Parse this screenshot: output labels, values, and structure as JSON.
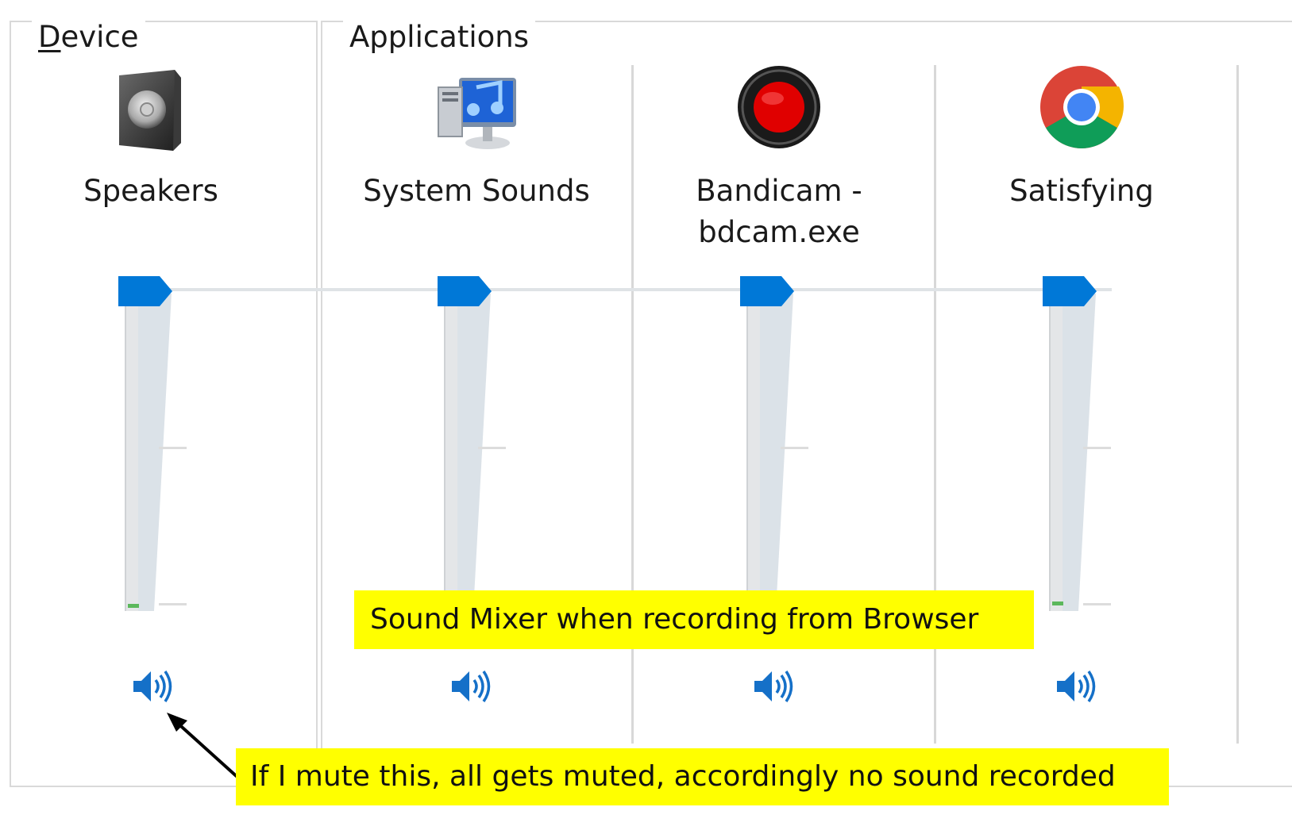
{
  "device": {
    "group_label_mnemonic": "D",
    "group_label_rest": "evice",
    "channel": {
      "name": "Speakers",
      "icon": "speaker-device-icon",
      "volume": 1.0,
      "muted": false
    }
  },
  "applications": {
    "group_label": "Applications",
    "channels": [
      {
        "name": "System Sounds",
        "icon": "system-sounds-icon",
        "volume": 1.0,
        "muted": false
      },
      {
        "name": "Bandicam -\nbdcam.exe",
        "icon": "bandicam-icon",
        "volume": 1.0,
        "muted": false
      },
      {
        "name": "Satisfying",
        "icon": "chrome-icon",
        "volume": 1.0,
        "muted": false
      }
    ]
  },
  "annotations": {
    "title_callout": "Sound Mixer when recording from Browser",
    "mute_callout": "If I mute this, all gets muted, accordingly no sound recorded"
  },
  "colors": {
    "accent": "#0078d7",
    "callout_bg": "#ffff00",
    "peak_meter": "#5cb85c"
  }
}
